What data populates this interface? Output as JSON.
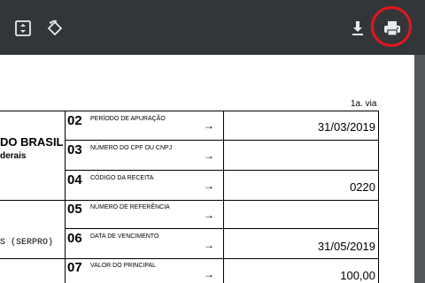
{
  "toolbar": {
    "icons": [
      "fit-page-icon",
      "rotate-icon",
      "download-icon",
      "print-icon"
    ],
    "highlight_color": "#e3161b"
  },
  "document": {
    "via": "1a. via",
    "left_title": "DO BRASIL",
    "left_subtitle": "derais",
    "left_org": "S (SERPRO)",
    "fields": [
      {
        "num": "02",
        "label": "PERÍODO DE APURAÇÃO",
        "arrow": "→",
        "value": "31/03/2019"
      },
      {
        "num": "03",
        "label": "NÚMERO DO CPF OU CNPJ",
        "arrow": "→",
        "value": ""
      },
      {
        "num": "04",
        "label": "CÓDIGO DA RECEITA",
        "arrow": "→",
        "value": "0220"
      },
      {
        "num": "05",
        "label": "NÚMERO DE REFERÊNCIA",
        "arrow": "→",
        "value": ""
      },
      {
        "num": "06",
        "label": "DATA DE VENCIMENTO",
        "arrow": "→",
        "value": "31/05/2019"
      },
      {
        "num": "07",
        "label": "VALOR DO PRINCIPAL",
        "arrow": "→",
        "value": "100,00"
      }
    ]
  }
}
